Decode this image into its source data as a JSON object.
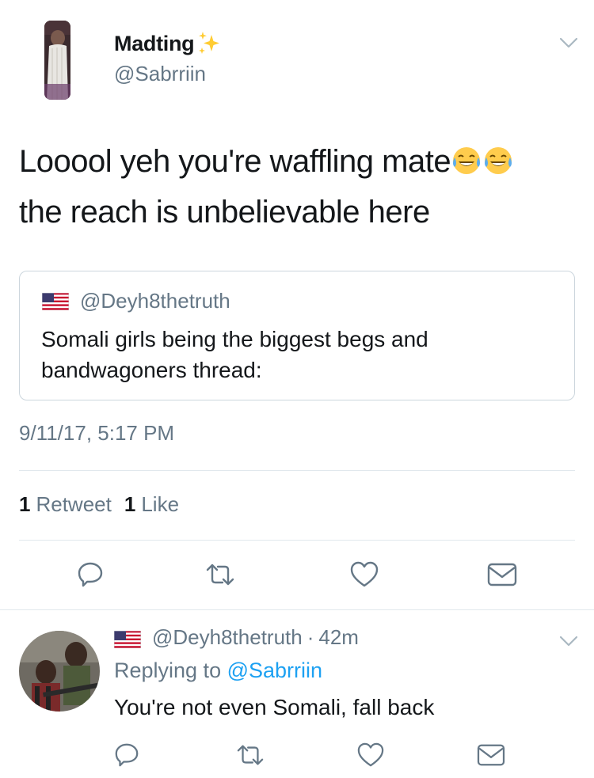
{
  "tweet": {
    "display_name": "Madting",
    "handle": "@Sabrriin",
    "text_line1": "Looool yeh you're waffling mate",
    "text_line2": "the reach is unbelievable here",
    "emoji": "face-with-tears-of-joy",
    "timestamp": "9/11/17, 5:17 PM",
    "retweet_count": "1",
    "retweet_label": "Retweet",
    "like_count": "1",
    "like_label": "Like"
  },
  "quote": {
    "handle": "@Deyh8thetruth",
    "text": "Somali girls being the biggest begs and bandwagoners thread:"
  },
  "reply": {
    "handle": "@Deyh8thetruth",
    "separator": "·",
    "time": "42m",
    "replying_prefix": "Replying to",
    "replying_to": "@Sabrriin",
    "text": "You're not even Somali, fall back"
  },
  "icons": [
    "reply-icon",
    "retweet-icon",
    "like-icon",
    "direct-message-icon",
    "chevron-down-icon",
    "us-flag-icon",
    "sparkles-icon"
  ],
  "colors": {
    "text": "#14171a",
    "secondary": "#657786",
    "link": "#1da1f2",
    "border": "#e1e8ed"
  }
}
